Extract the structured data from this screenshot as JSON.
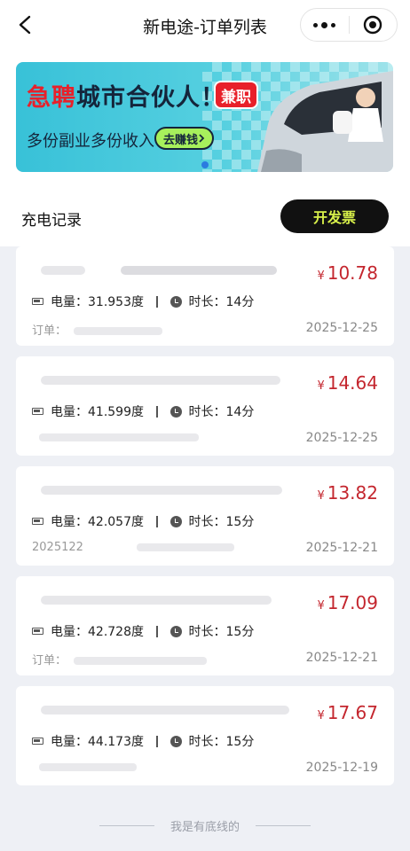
{
  "nav": {
    "title": "新电途-订单列表"
  },
  "banner": {
    "headline_red": "急聘",
    "headline_dark": "城市合伙人！",
    "tag": "兼职",
    "subline": "多份副业多份收入",
    "cta": "去赚钱"
  },
  "section": {
    "title": "充电记录",
    "invoice_button": "开发票"
  },
  "orders": [
    {
      "currency": "¥",
      "amount": "10.78",
      "energy_label": "电量：",
      "energy": "31.953度",
      "duration_label": "时长：",
      "duration": "14分",
      "order_label": "订单：",
      "date": "2025-12-25"
    },
    {
      "currency": "¥",
      "amount": "14.64",
      "energy_label": "电量：",
      "energy": "41.599度",
      "duration_label": "时长：",
      "duration": "14分",
      "order_label": "",
      "date": "2025-12-25"
    },
    {
      "currency": "¥",
      "amount": "13.82",
      "energy_label": "电量：",
      "energy": "42.057度",
      "duration_label": "时长：",
      "duration": "15分",
      "order_label": "2025122",
      "date": "2025-12-21"
    },
    {
      "currency": "¥",
      "amount": "17.09",
      "energy_label": "电量：",
      "energy": "42.728度",
      "duration_label": "时长：",
      "duration": "15分",
      "order_label": "订单：",
      "date": "2025-12-21"
    },
    {
      "currency": "¥",
      "amount": "17.67",
      "energy_label": "电量：",
      "energy": "44.173度",
      "duration_label": "时长：",
      "duration": "15分",
      "order_label": "",
      "date": "2025-12-19"
    }
  ],
  "footer": {
    "text": "我是有底线的"
  },
  "colors": {
    "price": "#c4262e",
    "invoice_text": "#d8f04a",
    "banner_red": "#e8202a"
  }
}
